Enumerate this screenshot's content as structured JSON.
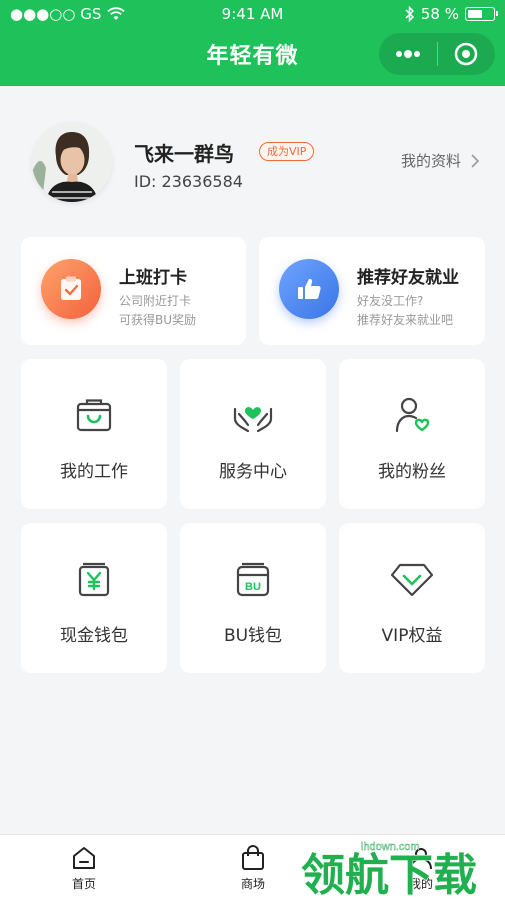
{
  "status_bar": {
    "carrier": "●●●○○ GS",
    "time": "9:41 AM",
    "battery_percent": "58 %"
  },
  "header": {
    "title": "年轻有微",
    "more_icon": "more-dots-icon",
    "close_icon": "target-circle-icon"
  },
  "profile": {
    "name": "飞来一群鸟",
    "vip_badge": "成为VIP",
    "id_text": "ID: 23636584",
    "link_label": "我的资料"
  },
  "promos": [
    {
      "title": "上班打卡",
      "line1": "公司附近打卡",
      "line2": "可获得BU奖励",
      "icon": "clipboard-check-icon"
    },
    {
      "title": "推荐好友就业",
      "line1": "好友没工作?",
      "line2": "推荐好友来就业吧",
      "icon": "thumbs-up-icon"
    }
  ],
  "grid": [
    {
      "label": "我的工作",
      "icon": "briefcase-icon"
    },
    {
      "label": "服务中心",
      "icon": "heart-hands-icon"
    },
    {
      "label": "我的粉丝",
      "icon": "user-heart-icon"
    },
    {
      "label": "现金钱包",
      "icon": "yen-wallet-icon"
    },
    {
      "label": "BU钱包",
      "icon": "bu-wallet-icon"
    },
    {
      "label": "VIP权益",
      "icon": "diamond-icon"
    }
  ],
  "tabbar": [
    {
      "label": "首页",
      "icon": "home-icon"
    },
    {
      "label": "商场",
      "icon": "shopping-bag-icon"
    },
    {
      "label": "我的",
      "icon": "user-icon"
    }
  ],
  "watermark": {
    "text": "领航下载",
    "site": "lhdown.com"
  },
  "colors": {
    "brand_green": "#1fc25a",
    "vip_orange": "#f26a3b",
    "icon_green": "#1fc25a"
  }
}
